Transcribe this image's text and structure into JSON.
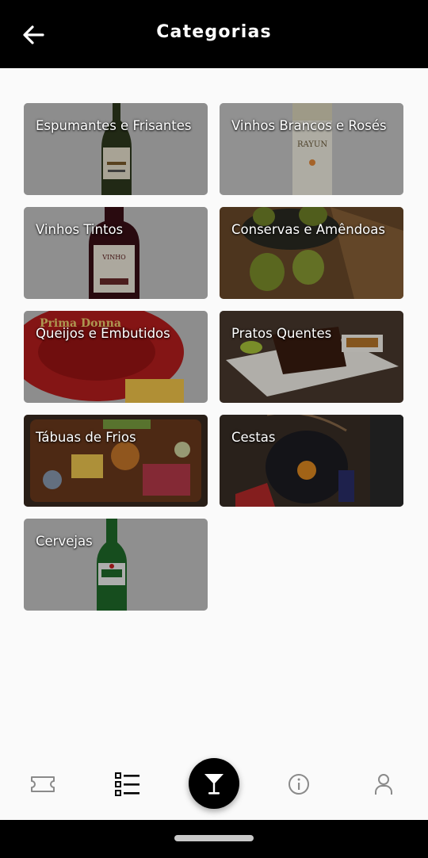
{
  "header": {
    "title": "Categorias",
    "back_icon": "arrow-left-icon"
  },
  "categories": [
    {
      "label": "Espumantes e Frisantes",
      "image": "sparkling-wine-bottle"
    },
    {
      "label": "Vinhos Brancos e Rosés",
      "image": "white-wine-bottle"
    },
    {
      "label": "Vinhos Tintos",
      "image": "red-wine-bottle"
    },
    {
      "label": "Conservas e Amêndoas",
      "image": "green-olives"
    },
    {
      "label": "Queijos e Embutidos",
      "image": "prima-donna-cheese"
    },
    {
      "label": "Pratos Quentes",
      "image": "hot-dish-plate"
    },
    {
      "label": "Tábuas de Frios",
      "image": "cold-cuts-board"
    },
    {
      "label": "Cestas",
      "image": "gift-basket"
    },
    {
      "label": "Cervejas",
      "image": "beer-bottle"
    }
  ],
  "bottom_nav": {
    "items": [
      {
        "icon": "ticket-icon"
      },
      {
        "icon": "list-icon"
      },
      {
        "icon": "cocktail-glass-icon",
        "active": true
      },
      {
        "icon": "info-icon"
      },
      {
        "icon": "user-icon"
      }
    ]
  },
  "colors": {
    "header_bg": "#000000",
    "page_bg": "#fafafa",
    "icon_gray": "#9e9e9e",
    "active_bg": "#000000"
  }
}
